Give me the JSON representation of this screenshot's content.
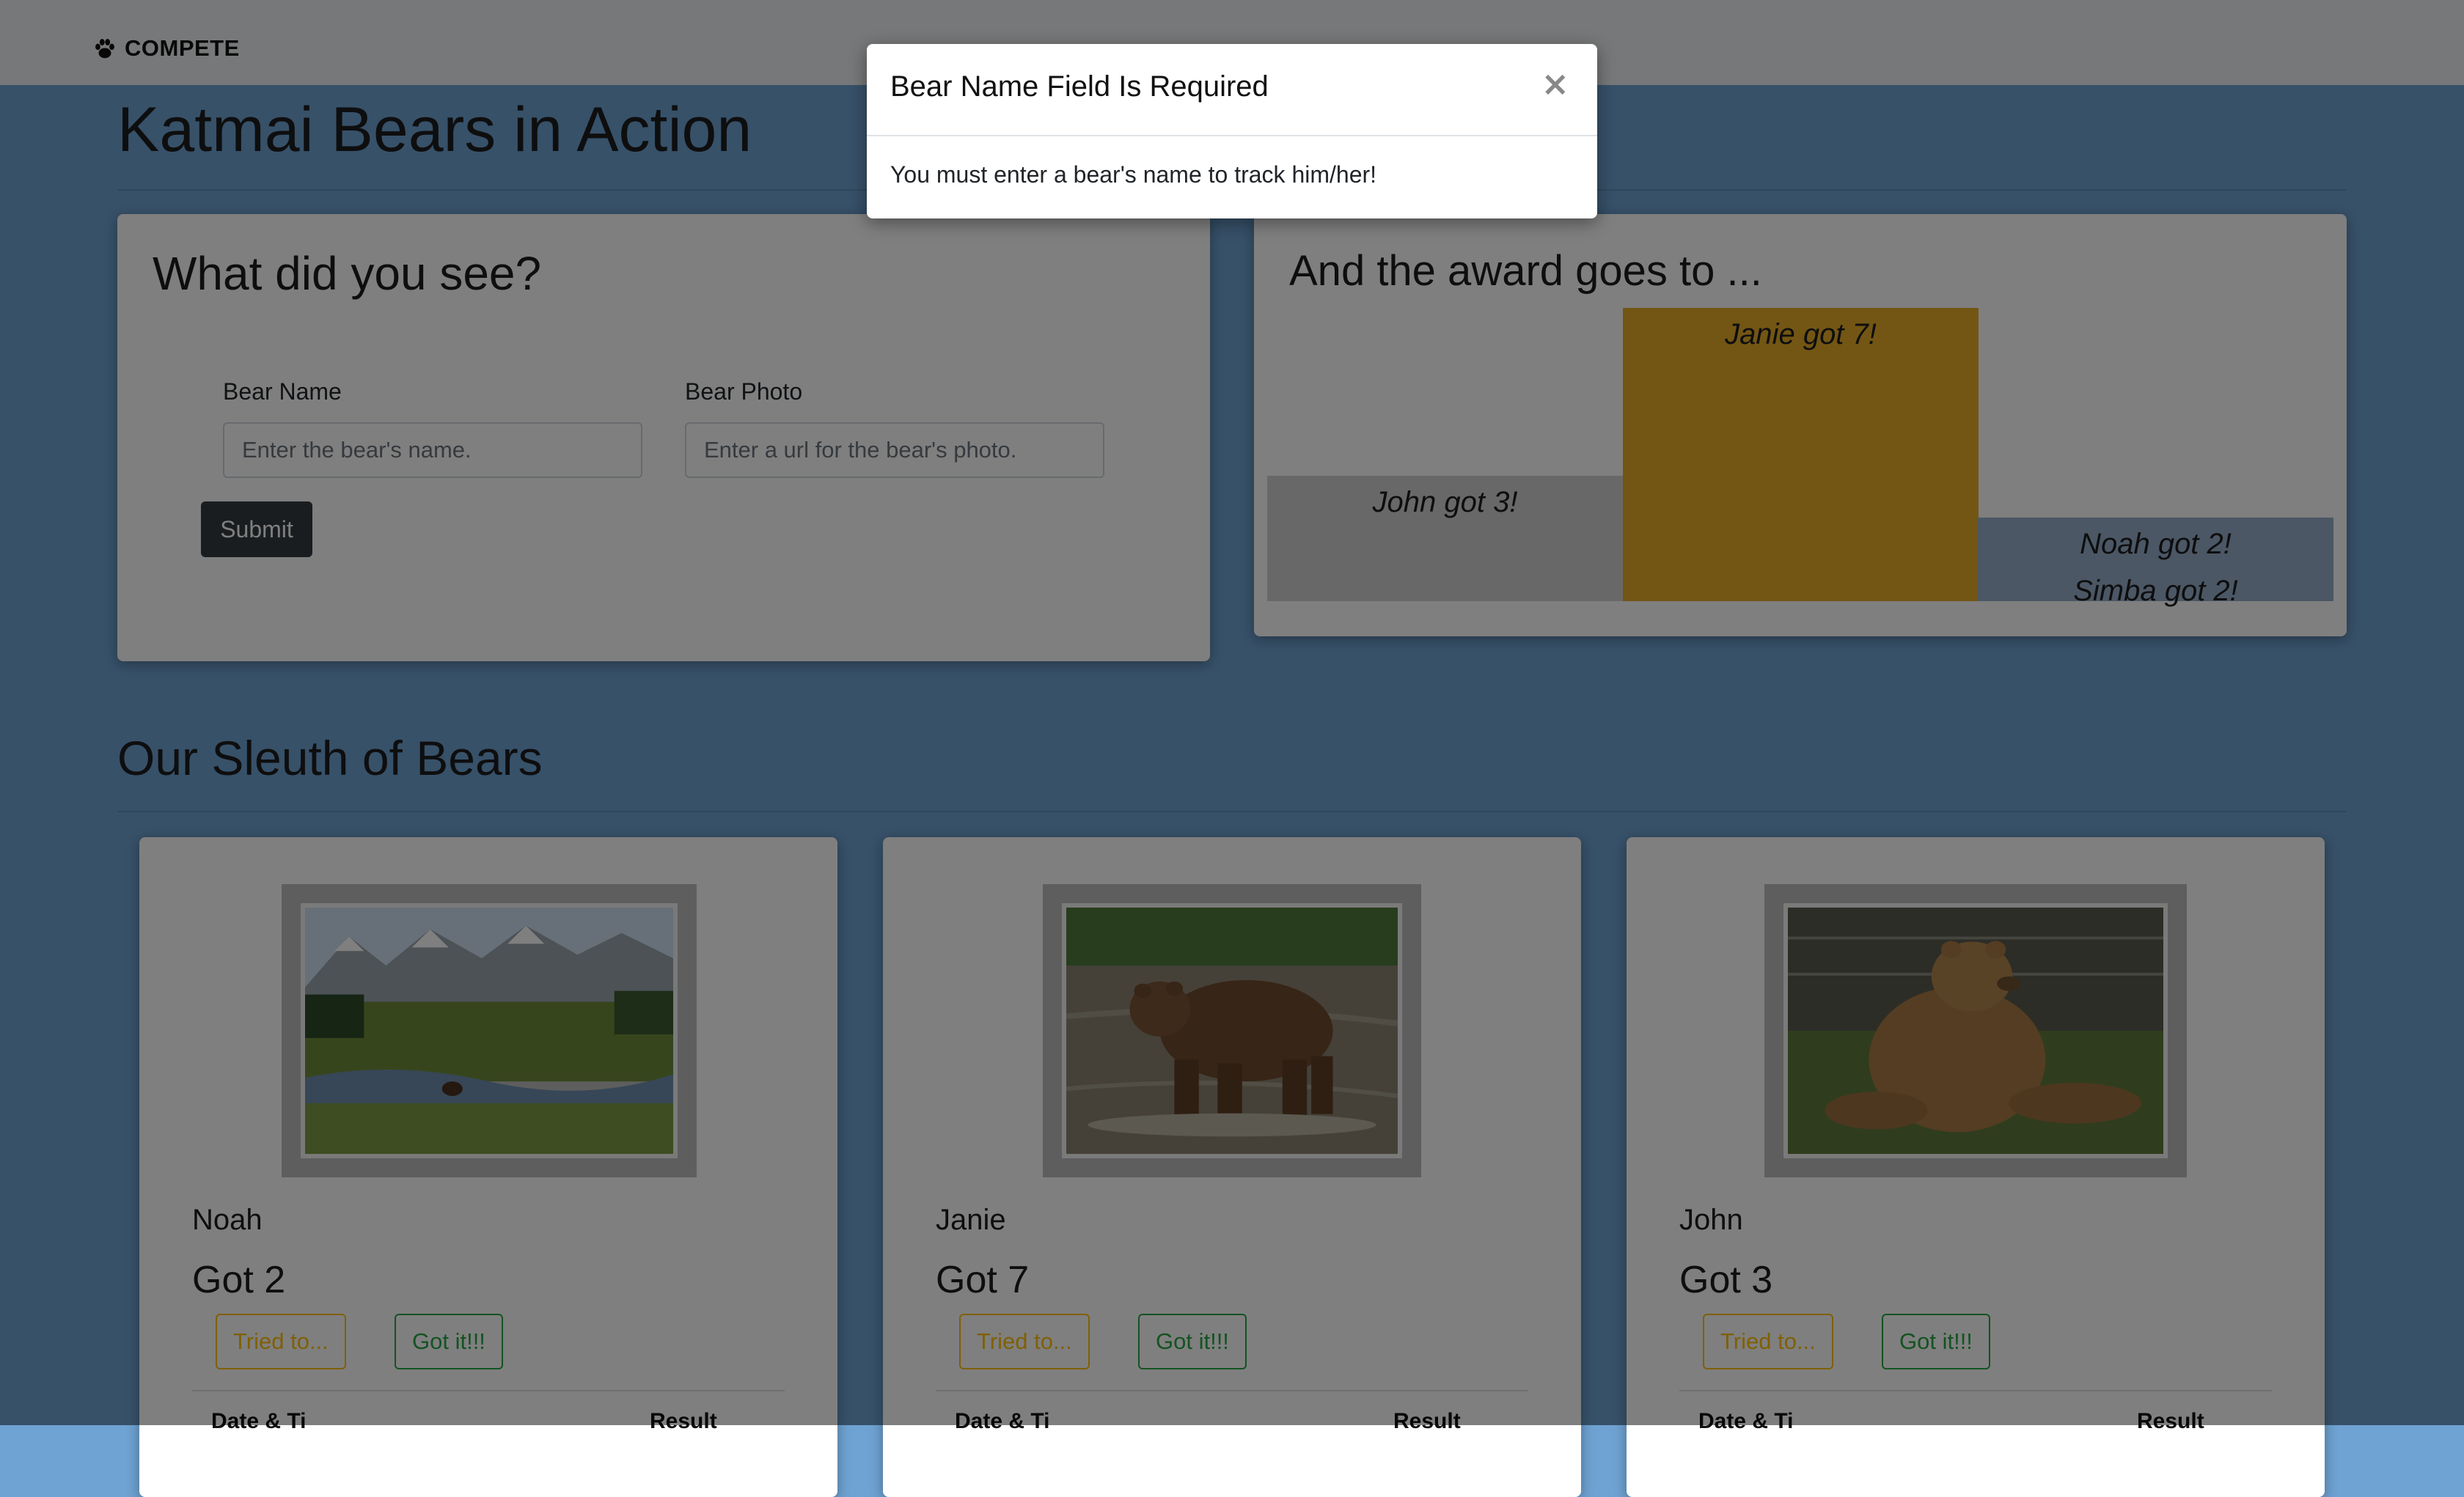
{
  "navbar": {
    "brand": "COMPETE",
    "icon": "paw-icon"
  },
  "page_title": "Katmai Bears in Action",
  "form": {
    "heading": "What did you see?",
    "name_label": "Bear Name",
    "name_placeholder": "Enter the bear's name.",
    "photo_label": "Bear Photo",
    "photo_placeholder": "Enter a url for the bear's photo.",
    "submit_label": "Submit"
  },
  "award": {
    "heading": "And the award goes to ...",
    "chart_data": {
      "type": "bar",
      "categories": [
        "John",
        "Janie",
        "Noah / Simba"
      ],
      "values": [
        3,
        7,
        2
      ],
      "labels": [
        [
          "John got 3!"
        ],
        [
          "Janie got 7!"
        ],
        [
          "Noah got 2!",
          "Simba got 2!"
        ]
      ],
      "colors": [
        "#d0d0d0",
        "#e6ac29",
        "#97aec8"
      ],
      "ylim": [
        0,
        7
      ]
    }
  },
  "sleuth": {
    "heading": "Our Sleuth of Bears",
    "bears": [
      {
        "name": "Noah",
        "count": "Got 2",
        "tried": "Tried to...",
        "got": "Got it!!!",
        "col_date": "Date & Ti",
        "col_result": "Result"
      },
      {
        "name": "Janie",
        "count": "Got 7",
        "tried": "Tried to...",
        "got": "Got it!!!",
        "col_date": "Date & Ti",
        "col_result": "Result"
      },
      {
        "name": "John",
        "count": "Got 3",
        "tried": "Tried to...",
        "got": "Got it!!!",
        "col_date": "Date & Ti",
        "col_result": "Result"
      }
    ]
  },
  "modal": {
    "title": "Bear Name Field Is Required",
    "close": "×",
    "body": "You must enter a bear's name to track him/her!"
  },
  "colors": {
    "page_bg": "#6fa3d3",
    "submit_bg": "#343a40",
    "tried": "#ffc107",
    "got": "#28a745"
  }
}
